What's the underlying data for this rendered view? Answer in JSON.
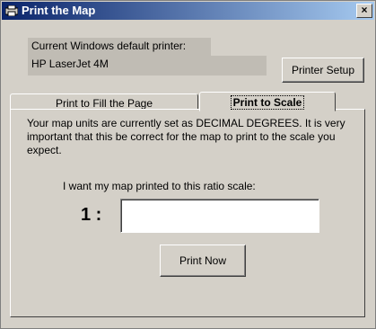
{
  "window": {
    "title": "Print the Map",
    "close_glyph": "×"
  },
  "printer": {
    "label": "Current Windows default printer:",
    "name": "HP LaserJet 4M",
    "setup_button": "Printer Setup"
  },
  "tabs": [
    {
      "label": "Print to Fill the Page",
      "active": false
    },
    {
      "label": "Print to Scale",
      "active": true
    }
  ],
  "scale_panel": {
    "message": "Your map units are currently set as DECIMAL DEGREES. It is very important that this be correct for the map to print to the scale you expect.",
    "ratio_label": "I want my map printed to this ratio scale:",
    "ratio_prefix": "1 :",
    "scale_value": "",
    "print_button": "Print Now"
  },
  "icons": {
    "app": "printer-map-icon"
  }
}
